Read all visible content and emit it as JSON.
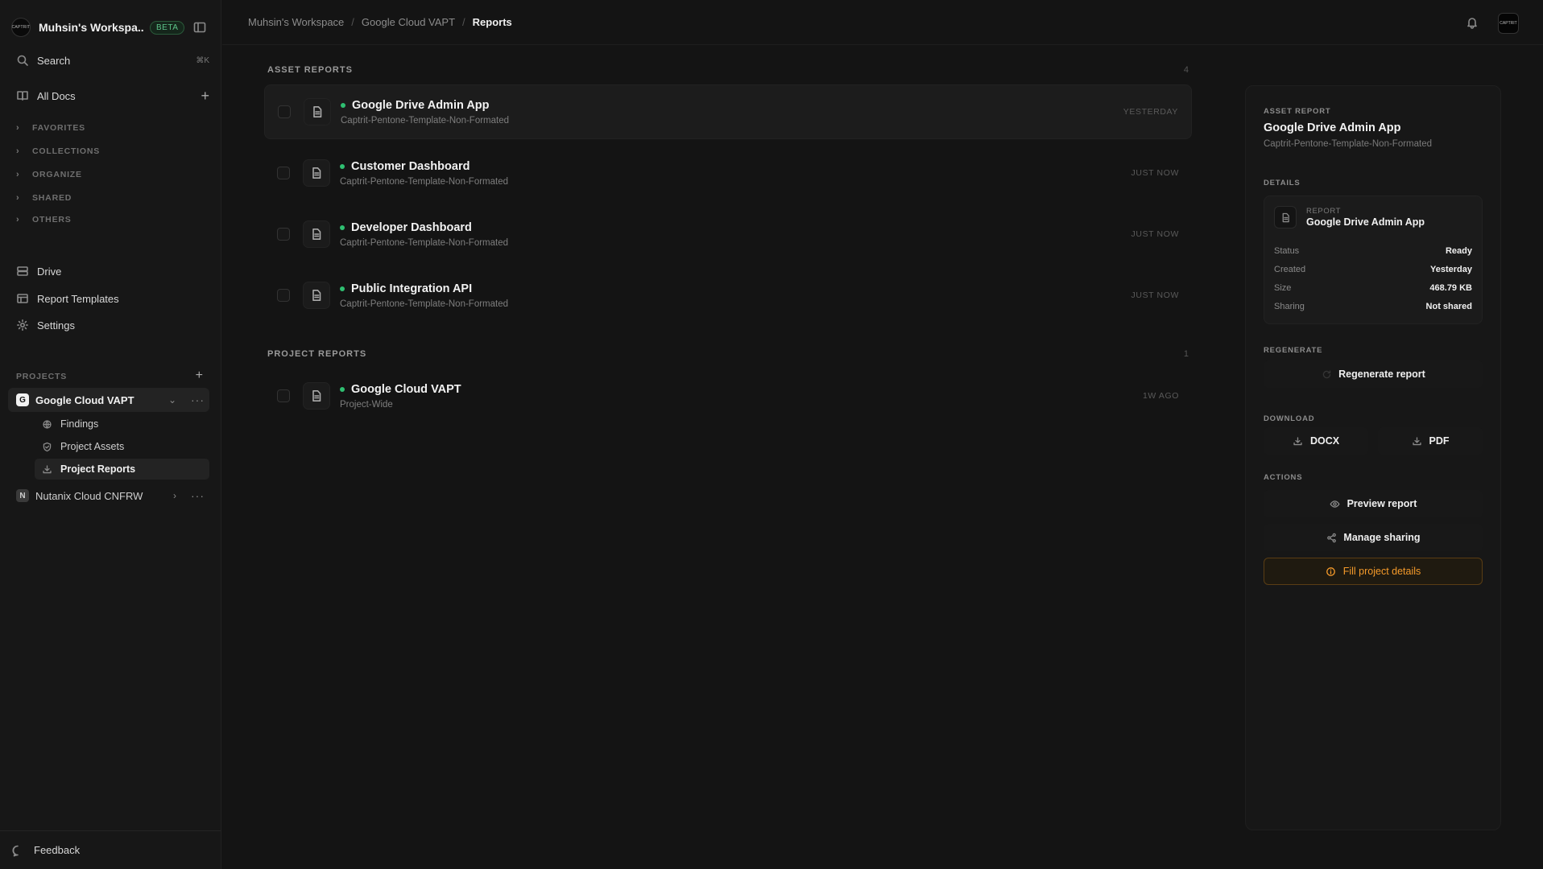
{
  "workspace": {
    "logo_text": "CAPTRIT",
    "name": "Muhsin's Workspa...",
    "badge": "BETA"
  },
  "search": {
    "label": "Search",
    "shortcut": "⌘K"
  },
  "nav": {
    "all_docs": "All Docs",
    "sections": [
      "FAVORITES",
      "COLLECTIONS",
      "ORGANIZE",
      "SHARED",
      "OTHERS"
    ],
    "drive": "Drive",
    "report_templates": "Report Templates",
    "settings": "Settings"
  },
  "projects": {
    "label": "PROJECTS",
    "items": [
      {
        "badge": "G",
        "name": "Google Cloud VAPT",
        "sub": [
          "Findings",
          "Project Assets",
          "Project Reports"
        ]
      },
      {
        "badge": "N",
        "name": "Nutanix Cloud CNFRW"
      }
    ]
  },
  "feedback": "Feedback",
  "breadcrumb": [
    "Muhsin's Workspace",
    "Google Cloud VAPT",
    "Reports"
  ],
  "topbar": {
    "avatar_text": "CAPTRIT"
  },
  "asset_reports": {
    "title": "ASSET REPORTS",
    "count": "4",
    "rows": [
      {
        "title": "Google Drive Admin App",
        "sub": "Captrit-Pentone-Template-Non-Formated",
        "time": "YESTERDAY"
      },
      {
        "title": "Customer Dashboard",
        "sub": "Captrit-Pentone-Template-Non-Formated",
        "time": "JUST NOW"
      },
      {
        "title": "Developer Dashboard",
        "sub": "Captrit-Pentone-Template-Non-Formated",
        "time": "JUST NOW"
      },
      {
        "title": "Public Integration API",
        "sub": "Captrit-Pentone-Template-Non-Formated",
        "time": "JUST NOW"
      }
    ]
  },
  "project_reports": {
    "title": "PROJECT REPORTS",
    "count": "1",
    "rows": [
      {
        "title": "Google Cloud VAPT",
        "sub": "Project-Wide",
        "time": "1W AGO"
      }
    ]
  },
  "panel": {
    "label": "ASSET REPORT",
    "title": "Google Drive Admin App",
    "sub": "Captrit-Pentone-Template-Non-Formated",
    "details_label": "DETAILS",
    "card_small": "REPORT",
    "card_name": "Google Drive Admin App",
    "details": [
      {
        "k": "Status",
        "v": "Ready"
      },
      {
        "k": "Created",
        "v": "Yesterday"
      },
      {
        "k": "Size",
        "v": "468.79 KB"
      },
      {
        "k": "Sharing",
        "v": "Not shared"
      }
    ],
    "regenerate_label": "REGENERATE",
    "regenerate_btn": "Regenerate report",
    "download_label": "DOWNLOAD",
    "docx": "DOCX",
    "pdf": "PDF",
    "actions_label": "ACTIONS",
    "preview": "Preview report",
    "sharing": "Manage sharing",
    "fill": "Fill project details"
  },
  "colors": {
    "accent_green": "#2fbf71",
    "warn_orange": "#f59a2a",
    "background": "#141414"
  }
}
